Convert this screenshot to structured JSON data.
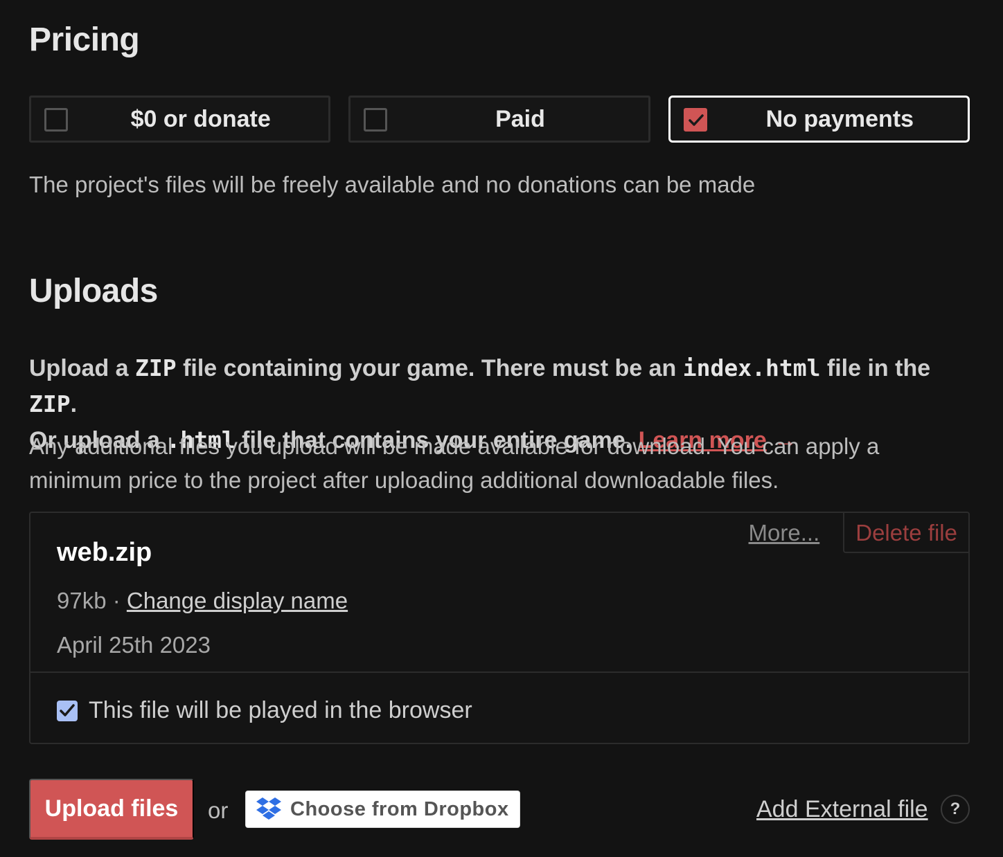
{
  "pricing": {
    "title": "Pricing",
    "options": [
      {
        "label": "$0 or donate",
        "selected": false
      },
      {
        "label": "Paid",
        "selected": false
      },
      {
        "label": "No payments",
        "selected": true
      }
    ],
    "description": "The project's files will be freely available and no donations can be made"
  },
  "uploads": {
    "title": "Uploads",
    "intro": {
      "p1": "Upload a ",
      "code_zip": "ZIP",
      "p2": " file containing your game. There must be an ",
      "code_index": "index.html",
      "p3": " file in the ",
      "code_zip2": "ZIP",
      "p4": ".",
      "p5": "Or upload a ",
      "code_html": ".html",
      "p6": " file that contains your entire game. ",
      "learn_more": "Learn more",
      "arrow": "→"
    },
    "description": "Any additional files you upload will be made available for download. You can apply a minimum price to the project after uploading additional downloadable files."
  },
  "file": {
    "name": "web.zip",
    "size": "97kb",
    "separator": " · ",
    "change_name": "Change display name",
    "date": "April 25th 2023",
    "more": "More...",
    "delete": "Delete file",
    "browser_label": "This file will be played in the browser",
    "browser_checked": true
  },
  "actions": {
    "upload": "Upload files",
    "or": "or",
    "dropbox": "Choose from Dropbox",
    "external": "Add External file",
    "help": "?"
  },
  "colors": {
    "accent": "#d05555",
    "background": "#131313",
    "checkbox_blue": "#a9c0f5"
  }
}
